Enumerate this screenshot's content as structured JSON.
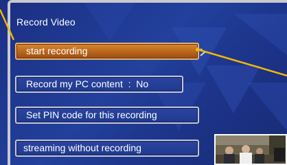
{
  "screen": {
    "title": "Record Video",
    "menu": [
      {
        "label": "start recording",
        "selected": true
      },
      {
        "label": "Record my PC content  :  No",
        "selected": false
      },
      {
        "label": "Set PIN code for this recording",
        "selected": false
      },
      {
        "label": "streaming without recording",
        "selected": false
      }
    ]
  },
  "colors": {
    "background": "#22409c",
    "selected_item": "#c9741f",
    "callout_line": "#f5b800",
    "item_border": "#c7c7d2"
  },
  "icons": [
    "chevron-right-icon",
    "video-thumbnail"
  ]
}
